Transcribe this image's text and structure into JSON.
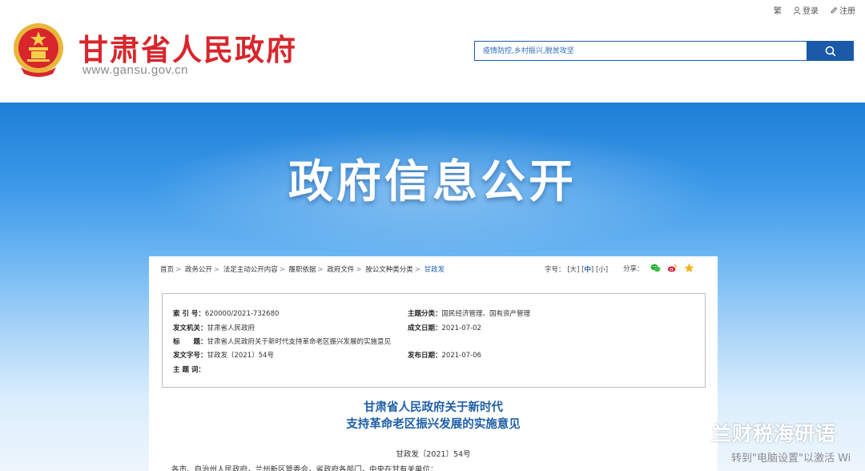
{
  "header": {
    "site_name": "甘肃省人民政府",
    "site_url": "www.gansu.gov.cn",
    "top_links": {
      "traditional": "繁",
      "login": "登录",
      "register": "注册"
    },
    "search": {
      "placeholder": "疫情防控,乡村振兴,脱贫攻坚"
    }
  },
  "banner": {
    "title": "政府信息公开"
  },
  "breadcrumb": [
    "首页",
    "政务公开",
    "法定主动公开内容",
    "履职依据",
    "政府文件",
    "按公文种类分类",
    "甘政发"
  ],
  "font_size": {
    "label": "字号：",
    "large": "大",
    "medium": "中",
    "small": "小"
  },
  "share": {
    "label": "分享："
  },
  "meta": {
    "index_label": "索 引 号：",
    "index_value": "620000/2021-732680",
    "category_label": "主题分类：",
    "category_value": "国民经济管理、国有资产管理",
    "issuer_label": "发文机关：",
    "issuer_value": "甘肃省人民政府",
    "created_label": "成文日期：",
    "created_value": "2021-07-02",
    "title_label": "标　　题：",
    "title_value": "甘肃省人民政府关于新时代支持革命老区振兴发展的实施意见",
    "doc_num_label": "发文字号：",
    "doc_num_value": "甘政发〔2021〕54号",
    "published_label": "发布日期：",
    "published_value": "2021-07-06",
    "keywords_label": "主 题 词："
  },
  "document": {
    "title_line1": "甘肃省人民政府关于新时代",
    "title_line2": "支持革命老区振兴发展的实施意见",
    "number": "甘政发〔2021〕54号",
    "recipients": "各市、自治州人民政府，兰州新区管委会，省政府各部门，中央在甘有关单位："
  },
  "watermark": {
    "text": "兰财税海研语",
    "activate": "转到\"电脑设置\"以激活 Wi"
  },
  "colors": {
    "brand_red": "#d8262c",
    "primary_blue": "#1f5fa8"
  }
}
